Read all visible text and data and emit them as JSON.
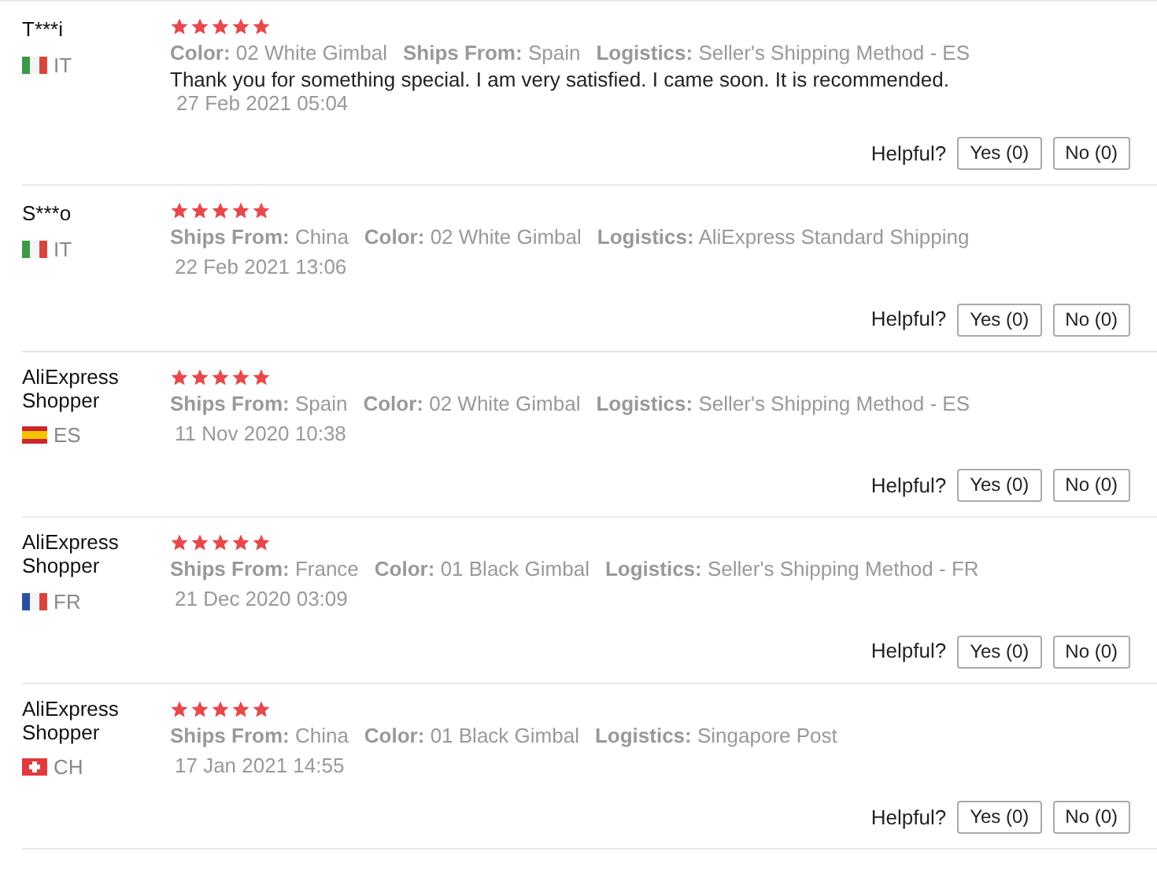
{
  "reviews": [
    {
      "user": "T***i",
      "country": "IT",
      "flag": {
        "kind": "italy"
      },
      "stars": 5,
      "attributes": [
        {
          "label": "Color:",
          "value": "02 White Gimbal"
        },
        {
          "label": "Ships From:",
          "value": "Spain"
        },
        {
          "label": "Logistics:",
          "value": "Seller's Shipping Method - ES"
        }
      ],
      "comment": "Thank you for something special. I am very satisfied. I came soon. It is recommended.",
      "date": "27 Feb 2021 05:04",
      "helpful_label": "Helpful?",
      "yes": "Yes (0)",
      "no": "No (0)"
    },
    {
      "user": "S***o",
      "country": "IT",
      "flag": {
        "kind": "italy"
      },
      "stars": 5,
      "attributes": [
        {
          "label": "Ships From:",
          "value": "China"
        },
        {
          "label": "Color:",
          "value": "02 White Gimbal"
        },
        {
          "label": "Logistics:",
          "value": "AliExpress Standard Shipping"
        }
      ],
      "date": "22 Feb 2021 13:06",
      "helpful_label": "Helpful?",
      "yes": "Yes (0)",
      "no": "No (0)"
    },
    {
      "user": "AliExpress Shopper",
      "country": "ES",
      "flag": {
        "kind": "spain"
      },
      "stars": 5,
      "attributes": [
        {
          "label": "Ships From:",
          "value": "Spain"
        },
        {
          "label": "Color:",
          "value": "02 White Gimbal"
        },
        {
          "label": "Logistics:",
          "value": "Seller's Shipping Method - ES"
        }
      ],
      "date": "11 Nov 2020 10:38",
      "helpful_label": "Helpful?",
      "yes": "Yes (0)",
      "no": "No (0)"
    },
    {
      "user": "AliExpress Shopper",
      "country": "FR",
      "flag": {
        "kind": "france"
      },
      "stars": 5,
      "attributes": [
        {
          "label": "Ships From:",
          "value": "France"
        },
        {
          "label": "Color:",
          "value": "01 Black Gimbal"
        },
        {
          "label": "Logistics:",
          "value": "Seller's Shipping Method - FR"
        }
      ],
      "date": "21 Dec 2020 03:09",
      "helpful_label": "Helpful?",
      "yes": "Yes (0)",
      "no": "No (0)"
    },
    {
      "user": "AliExpress Shopper",
      "country": "CH",
      "flag": {
        "kind": "switzerland"
      },
      "stars": 5,
      "attributes": [
        {
          "label": "Ships From:",
          "value": "China"
        },
        {
          "label": "Color:",
          "value": "01 Black Gimbal"
        },
        {
          "label": "Logistics:",
          "value": "Singapore Post"
        }
      ],
      "date": "17 Jan 2021 14:55",
      "helpful_label": "Helpful?",
      "yes": "Yes (0)",
      "no": "No (0)"
    }
  ]
}
